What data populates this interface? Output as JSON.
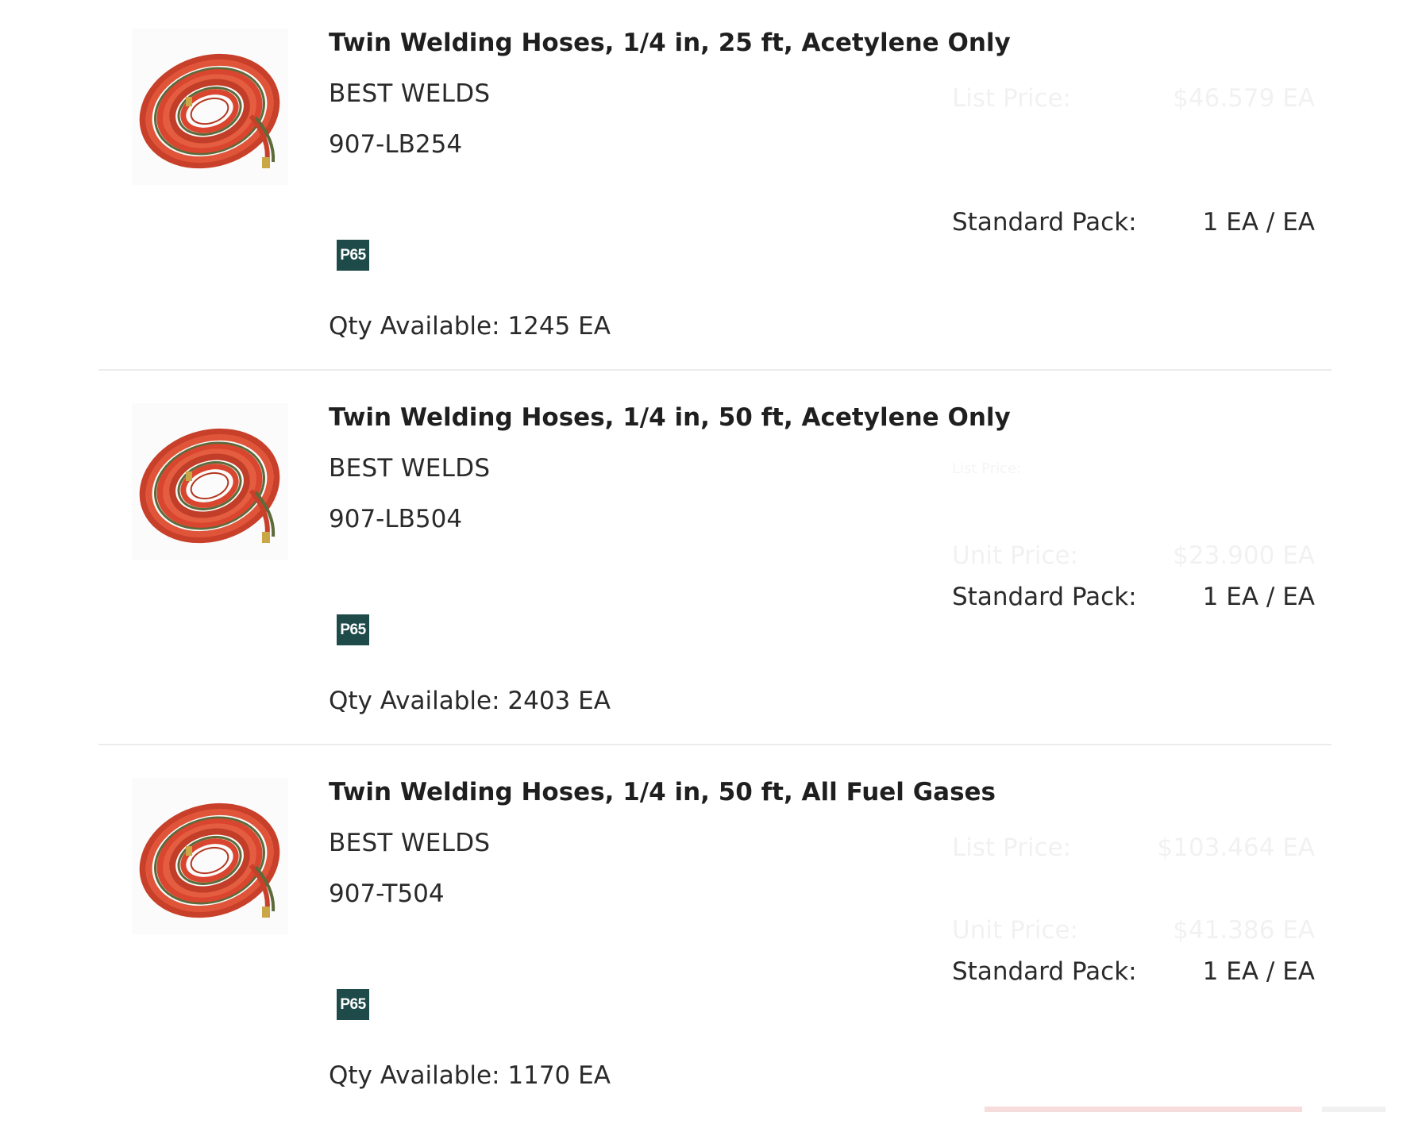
{
  "products": [
    {
      "title": "Twin Welding Hoses, 1/4 in, 25 ft, Acetylene Only",
      "brand": "BEST WELDS",
      "sku": "907-LB254",
      "badge": "P65",
      "qty_available": "Qty Available: 1245 EA",
      "pricing": {
        "list_price_label": "List Price:",
        "list_price_value": "$46.579 EA",
        "standard_pack_label": "Standard Pack:",
        "standard_pack_value": "1 EA / EA"
      },
      "image_icon": "welding-hose-coil"
    },
    {
      "title": "Twin Welding Hoses, 1/4 in, 50 ft, Acetylene Only",
      "brand": "BEST WELDS",
      "sku": "907-LB504",
      "badge": "P65",
      "qty_available": "Qty Available: 2403 EA",
      "pricing": {
        "list_price_label": "List Price:",
        "unit_price_label": "Unit Price:",
        "unit_price_value": "$23.900 EA",
        "standard_pack_label": "Standard Pack:",
        "standard_pack_value": "1 EA / EA"
      },
      "image_icon": "welding-hose-coil"
    },
    {
      "title": "Twin Welding Hoses, 1/4 in, 50 ft, All Fuel Gases",
      "brand": "BEST WELDS",
      "sku": "907-T504",
      "badge": "P65",
      "qty_available": "Qty Available: 1170 EA",
      "pricing": {
        "list_price_label": "List Price:",
        "list_price_value": "$103.464 EA",
        "unit_price_label": "Unit Price:",
        "unit_price_value": "$41.386 EA",
        "standard_pack_label": "Standard Pack:",
        "standard_pack_value": "1 EA / EA"
      },
      "image_icon": "welding-hose-coil"
    }
  ],
  "colors": {
    "hose_red": "#d9452e",
    "hose_green": "#5b6b3a",
    "badge_bg": "#1f4a4a",
    "divider": "#ececec",
    "text": "#2a2a2a"
  }
}
